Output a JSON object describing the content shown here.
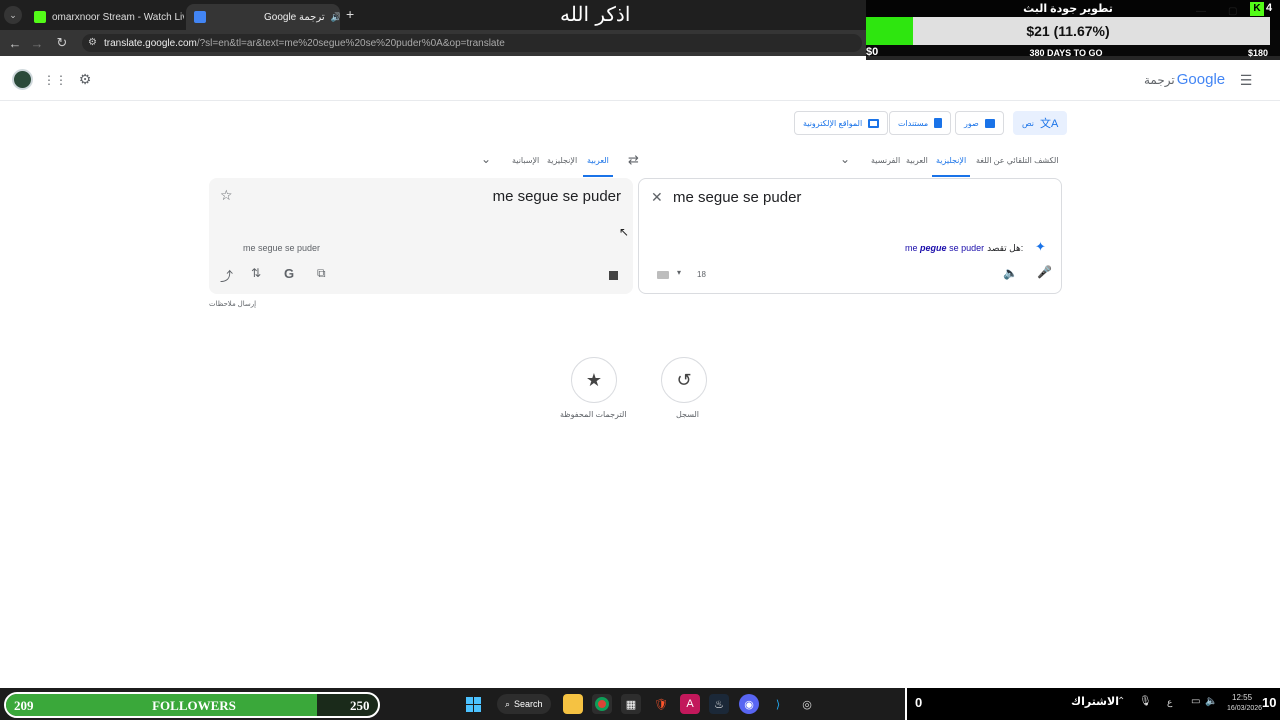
{
  "browser": {
    "tabs": [
      {
        "title": "omarxnoor Stream - Watch Live",
        "favicon_color": "#53fc18"
      },
      {
        "title": "Google ترجمة",
        "favicon_color": "#4285f4"
      }
    ],
    "url_host": "translate.google.com",
    "url_rest": "/?sl=en&tl=ar&text=me%20segue%20se%20puder%0A&op=translate"
  },
  "overlay": {
    "dhikr": "اذكر الله",
    "goal_title": "تطوير جودة البث",
    "goal_amount": "$21 (11.67%)",
    "goal_min": "$0",
    "goal_max": "$180",
    "goal_days": "380 DAYS TO GO",
    "goal_progress": 0.1167
  },
  "translate": {
    "logo": "Google",
    "logo_suffix": "ترجمة",
    "modes": [
      "نص",
      "صور",
      "مستندات",
      "المواقع الإلكترونية"
    ],
    "source_langs": [
      "الكشف التلقائي عن اللغة",
      "الإنجليزية",
      "العربية",
      "الفرنسية"
    ],
    "target_langs": [
      "العربية",
      "الإنجليزية",
      "الإسبانية"
    ],
    "source_text": "me segue se puder",
    "did_you_mean_label": "هل تقصد:",
    "did_you_mean_pre": "me",
    "did_you_mean_bold": "pegue",
    "did_you_mean_post": "se puder",
    "char_count": "18",
    "translated_text": "me segue se puder",
    "transliteration": "me segue se puder",
    "feedback": "إرسال ملاحظات",
    "history_label": "السجل",
    "saved_label": "الترجمات المحفوظة"
  },
  "stream": {
    "followers_current": "209",
    "followers_label": "FOLLOWERS",
    "followers_goal": "250",
    "followers_progress": 0.836,
    "subs_count": "0",
    "subs_label": "الاشتراك",
    "subs_goal": "10"
  },
  "taskbar": {
    "search_label": "Search",
    "time": "12:55",
    "date": "16/03/2026",
    "lang_indicator": "ع"
  }
}
